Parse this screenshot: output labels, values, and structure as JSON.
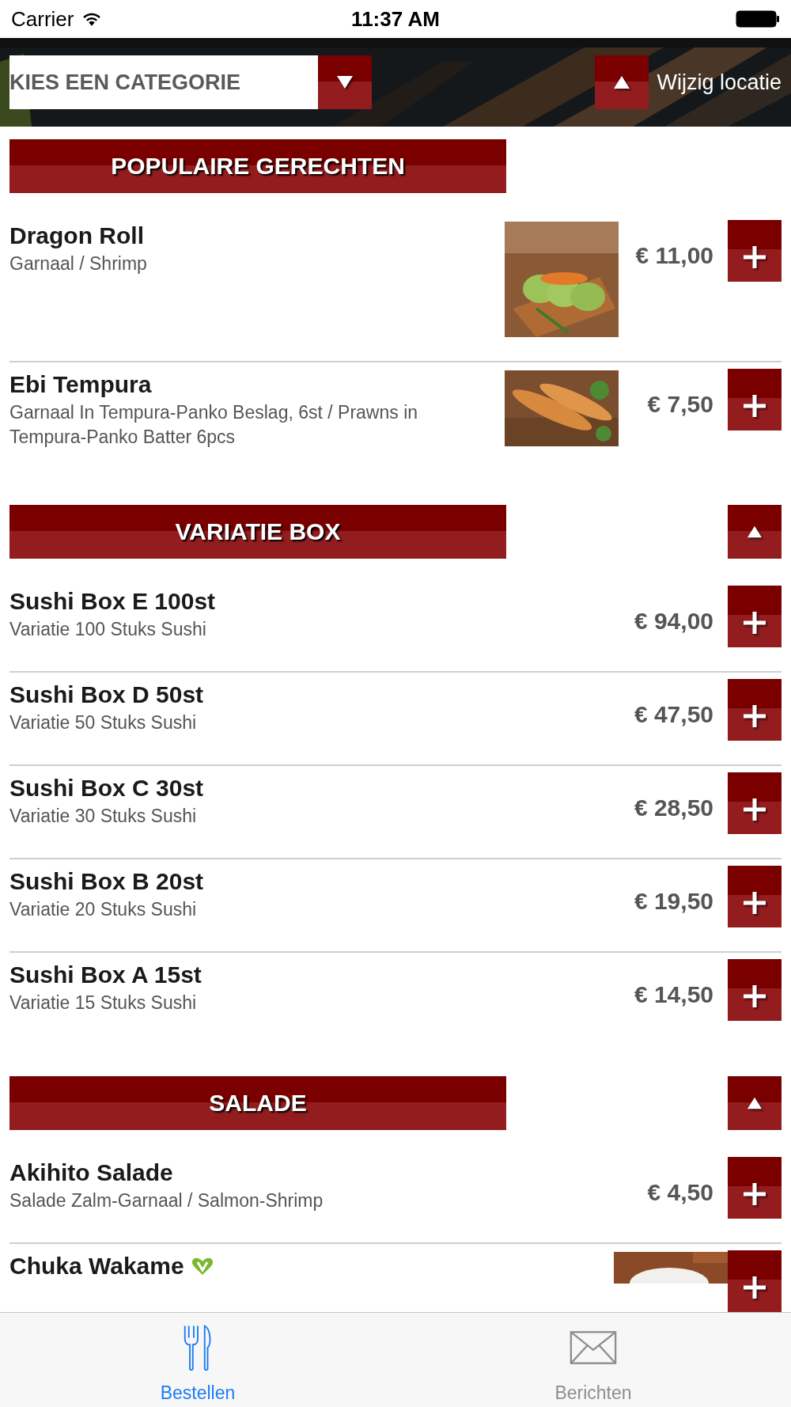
{
  "status_bar": {
    "carrier": "Carrier",
    "time": "11:37 AM"
  },
  "header": {
    "category_select": {
      "placeholder": "KIES EEN CATEGORIE"
    },
    "location_button": {
      "label": "Wijzig locatie"
    }
  },
  "sections": [
    {
      "title": "POPULAIRE GERECHTEN",
      "collapsible": false,
      "items": [
        {
          "name": "Dragon Roll",
          "description": "Garnaal / Shrimp",
          "price": "€ 11,00",
          "kind": "picture",
          "vegetarian": false
        },
        {
          "name": "Ebi Tempura",
          "description": "Garnaal In Tempura-Panko Beslag, 6st / Prawns in Tempura-Panko Batter 6pcs",
          "price": "€ 7,50",
          "kind": "picture",
          "vegetarian": false
        }
      ]
    },
    {
      "title": "VARIATIE BOX",
      "collapsible": true,
      "expanded": true,
      "items": [
        {
          "name": "Sushi Box E 100st",
          "description": "Variatie 100 Stuks Sushi",
          "price": "€ 94,00",
          "kind": "plain",
          "vegetarian": false
        },
        {
          "name": "Sushi Box D 50st",
          "description": "Variatie 50 Stuks Sushi",
          "price": "€ 47,50",
          "kind": "plain",
          "vegetarian": false
        },
        {
          "name": "Sushi Box C 30st",
          "description": "Variatie 30 Stuks Sushi",
          "price": "€ 28,50",
          "kind": "plain",
          "vegetarian": false
        },
        {
          "name": "Sushi Box B 20st",
          "description": "Variatie 20 Stuks Sushi",
          "price": "€ 19,50",
          "kind": "plain",
          "vegetarian": false
        },
        {
          "name": "Sushi Box A 15st",
          "description": "Variatie 15 Stuks Sushi",
          "price": "€ 14,50",
          "kind": "plain",
          "vegetarian": false
        }
      ]
    },
    {
      "title": "SALADE",
      "collapsible": true,
      "expanded": true,
      "items": [
        {
          "name": "Akihito Salade",
          "description": "Salade Zalm-Garnaal / Salmon-Shrimp",
          "price": "€ 4,50",
          "kind": "plain",
          "vegetarian": false
        },
        {
          "name": "Chuka Wakame",
          "kind": "picture",
          "vegetarian": true
        }
      ]
    }
  ],
  "tab_bar": [
    {
      "label": "Bestellen",
      "kind": "order",
      "selected": true
    },
    {
      "label": "Berichten",
      "kind": "messages",
      "selected": false
    }
  ]
}
